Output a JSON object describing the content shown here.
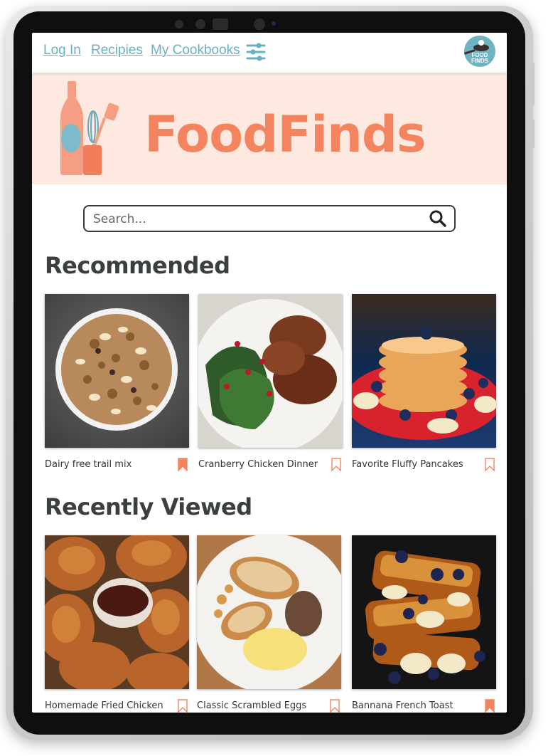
{
  "nav": {
    "links": [
      "Log In",
      "Recipies",
      "My Cookbooks"
    ],
    "filter_icon": "sliders-icon",
    "logo_text_line1": "FOOD",
    "logo_text_line2": "FINDS"
  },
  "hero": {
    "title": "FoodFinds",
    "illustration": "bottle-and-utensils-icon"
  },
  "search": {
    "placeholder": "Search...",
    "value": "",
    "icon": "search-icon"
  },
  "recommended": {
    "title": "Recommended",
    "items": [
      {
        "name": "Dairy free trail mix",
        "bookmarked": true
      },
      {
        "name": "Cranberry Chicken Dinner",
        "bookmarked": false
      },
      {
        "name": "Favorite Fluffy Pancakes",
        "bookmarked": false
      }
    ]
  },
  "recently_viewed": {
    "title": "Recently Viewed",
    "items": [
      {
        "name": "Homemade Fried Chicken",
        "bookmarked": false
      },
      {
        "name": "Classic Scrambled Eggs",
        "bookmarked": false
      },
      {
        "name": "Bannana French Toast",
        "bookmarked": true
      }
    ]
  },
  "colors": {
    "accent": "#f48460",
    "link": "#6ab0c0",
    "hero_bg": "#fde9e0",
    "heading": "#3b3f3f"
  }
}
